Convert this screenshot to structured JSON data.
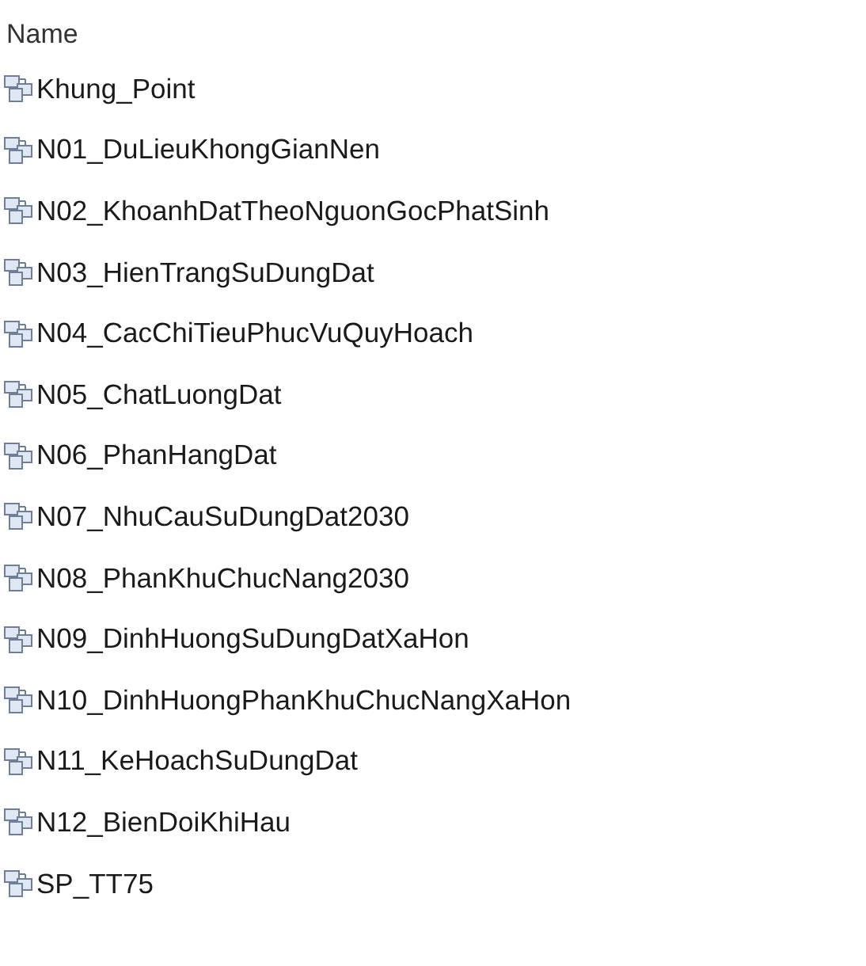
{
  "header": {
    "label": "Name"
  },
  "items": [
    {
      "name": "Khung_Point"
    },
    {
      "name": "N01_DuLieuKhongGianNen"
    },
    {
      "name": "N02_KhoanhDatTheoNguonGocPhatSinh"
    },
    {
      "name": "N03_HienTrangSuDungDat"
    },
    {
      "name": "N04_CacChiTieuPhucVuQuyHoach"
    },
    {
      "name": "N05_ChatLuongDat"
    },
    {
      "name": "N06_PhanHangDat"
    },
    {
      "name": "N07_NhuCauSuDungDat2030"
    },
    {
      "name": "N08_PhanKhuChucNang2030"
    },
    {
      "name": "N09_DinhHuongSuDungDatXaHon"
    },
    {
      "name": "N10_DinhHuongPhanKhuChucNangXaHon"
    },
    {
      "name": "N11_KeHoachSuDungDat"
    },
    {
      "name": "N12_BienDoiKhiHau"
    },
    {
      "name": "SP_TT75"
    }
  ]
}
